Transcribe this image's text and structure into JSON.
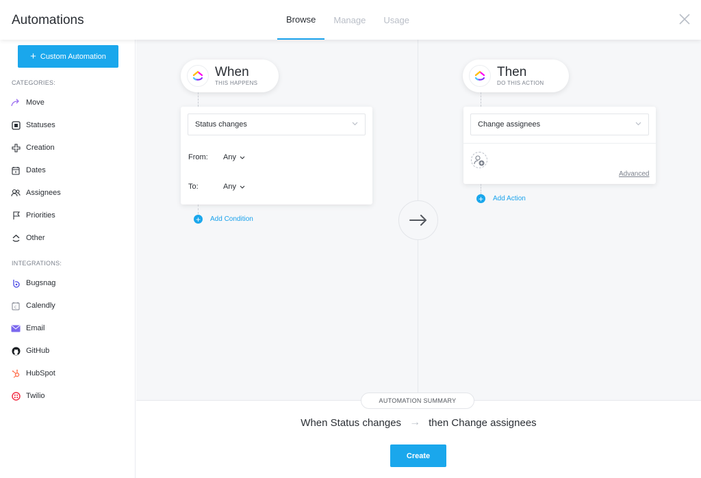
{
  "header": {
    "title": "Automations",
    "tabs": [
      {
        "label": "Browse",
        "active": true
      },
      {
        "label": "Manage",
        "active": false
      },
      {
        "label": "Usage",
        "active": false
      }
    ]
  },
  "sidebar": {
    "custom_button": "Custom Automation",
    "categories_title": "CATEGORIES:",
    "categories": [
      {
        "label": "Move",
        "icon": "move-arrow-icon"
      },
      {
        "label": "Statuses",
        "icon": "status-square-icon"
      },
      {
        "label": "Creation",
        "icon": "plus-outline-icon"
      },
      {
        "label": "Dates",
        "icon": "calendar-icon"
      },
      {
        "label": "Assignees",
        "icon": "users-icon"
      },
      {
        "label": "Priorities",
        "icon": "flag-icon"
      },
      {
        "label": "Other",
        "icon": "clickup-icon"
      }
    ],
    "integrations_title": "INTEGRATIONS:",
    "integrations": [
      {
        "label": "Bugsnag",
        "icon": "bugsnag-icon"
      },
      {
        "label": "Calendly",
        "icon": "calendly-icon"
      },
      {
        "label": "Email",
        "icon": "email-icon"
      },
      {
        "label": "GitHub",
        "icon": "github-icon"
      },
      {
        "label": "HubSpot",
        "icon": "hubspot-icon"
      },
      {
        "label": "Twilio",
        "icon": "twilio-icon"
      }
    ]
  },
  "when": {
    "title": "When",
    "subtitle": "THIS HAPPENS",
    "trigger": "Status changes",
    "from_label": "From:",
    "from_value": "Any",
    "to_label": "To:",
    "to_value": "Any",
    "add_condition": "Add Condition"
  },
  "then": {
    "title": "Then",
    "subtitle": "DO THIS ACTION",
    "action": "Change assignees",
    "advanced": "Advanced",
    "add_action": "Add Action"
  },
  "summary": {
    "badge": "AUTOMATION SUMMARY",
    "when_text": "When Status changes",
    "arrow": "→",
    "then_text": "then Change assignees",
    "create_button": "Create"
  },
  "colors": {
    "accent": "#1aa7ec",
    "text": "#2a2e34",
    "muted": "#7c828d",
    "canvas_bg": "#f6f7f9"
  }
}
